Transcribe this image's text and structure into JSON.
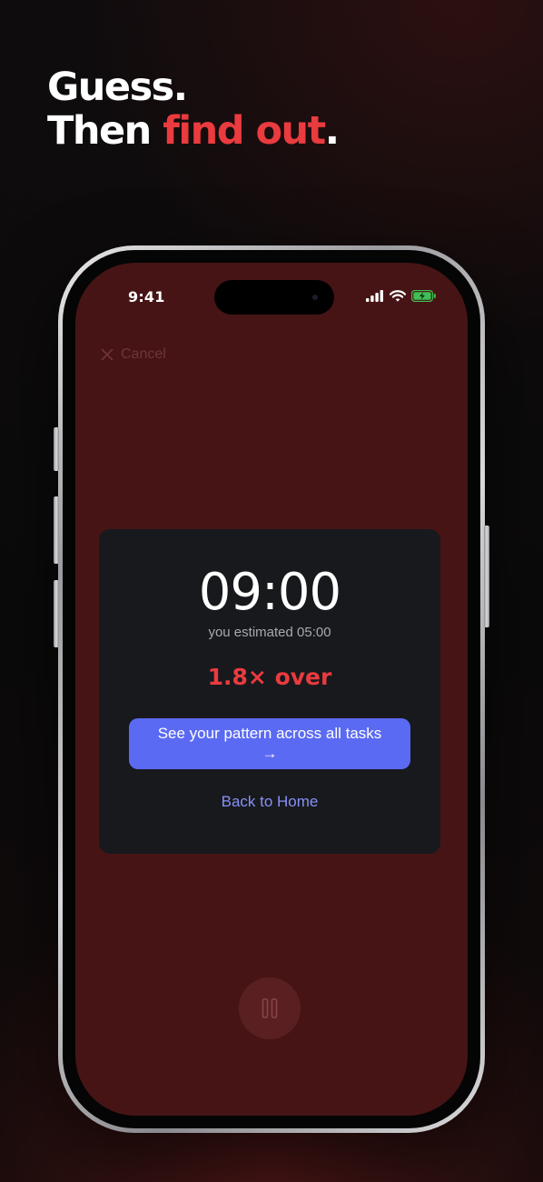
{
  "headline": {
    "line1": "Guess.",
    "line2_prefix": "Then ",
    "line2_accent": "find out",
    "line2_suffix": "."
  },
  "status_bar": {
    "time": "9:41",
    "icons": [
      "cellular-signal-icon",
      "wifi-icon",
      "battery-charging-icon"
    ]
  },
  "nav": {
    "cancel_label": "Cancel",
    "cancel_icon": "close-icon"
  },
  "result": {
    "elapsed": "09:00",
    "estimate_text": "you estimated 05:00",
    "ratio_text": "1.8× over",
    "pattern_button_label": "See your pattern across all tasks →",
    "home_link_label": "Back to Home"
  },
  "controls": {
    "pause_icon": "pause-icon"
  },
  "colors": {
    "accent_red": "#ea3b3f",
    "button_blue": "#5b6af2",
    "link_blue": "#8790f5",
    "screen_background": "#471415",
    "card_background": "#17191d"
  }
}
